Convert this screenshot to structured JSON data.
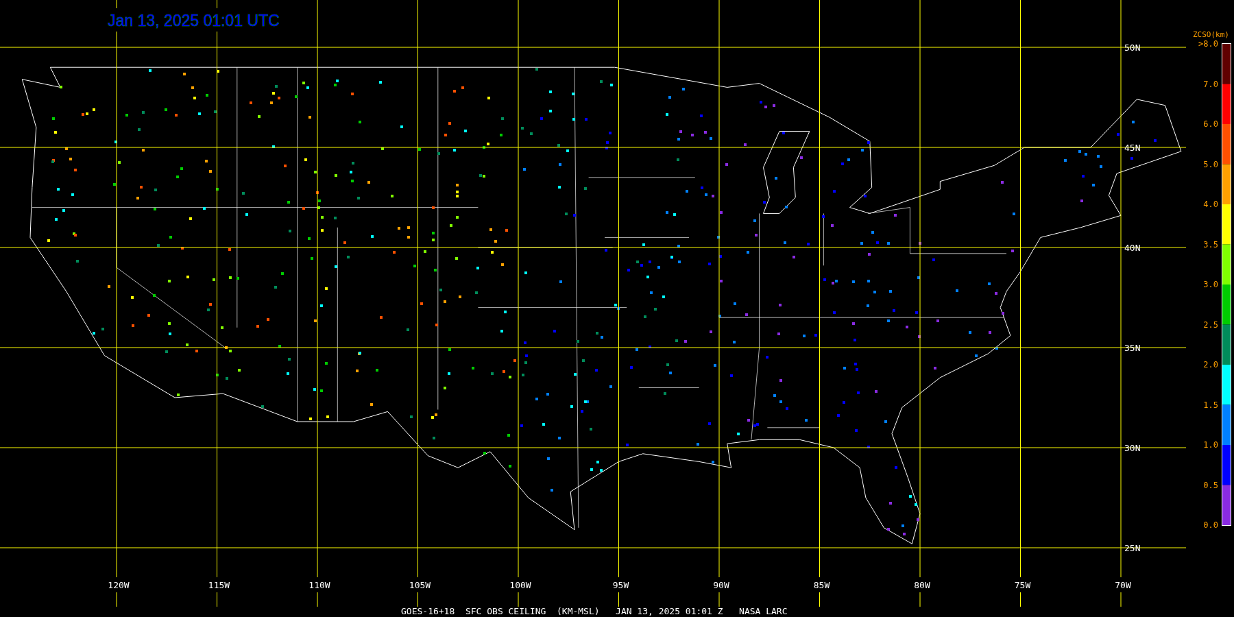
{
  "title": "Jan 13, 2025 01:01 UTC",
  "longitude_labels": [
    "120W",
    "115W",
    "110W",
    "105W",
    "100W",
    "95W",
    "90W",
    "85W",
    "80W",
    "75W",
    "70W"
  ],
  "latitude_labels": [
    "50N",
    "45N",
    "40N",
    "35N",
    "30N",
    "25N"
  ],
  "legend": {
    "title": "ZCSO(km)",
    "ticks": [
      ">8.0",
      "7.0",
      "6.0",
      "5.0",
      "4.0",
      "3.5",
      "3.0",
      "2.5",
      "2.0",
      "1.5",
      "1.0",
      "0.5",
      "0.0"
    ],
    "bands": [
      {
        "color": "#600000"
      },
      {
        "color": "#ff0000"
      },
      {
        "color": "#ff5000"
      },
      {
        "color": "#ffa000"
      },
      {
        "color": "#ffff00"
      },
      {
        "color": "#80ff00"
      },
      {
        "color": "#00cc00"
      },
      {
        "color": "#008c5a"
      },
      {
        "color": "#00ffff"
      },
      {
        "color": "#0080ff"
      },
      {
        "color": "#0000ff"
      },
      {
        "color": "#8a2be2"
      }
    ]
  },
  "footer": "GOES-16+18  SFC OBS CEILING  (KM-MSL)   JAN 13, 2025 01:01 Z   NASA LARC"
}
